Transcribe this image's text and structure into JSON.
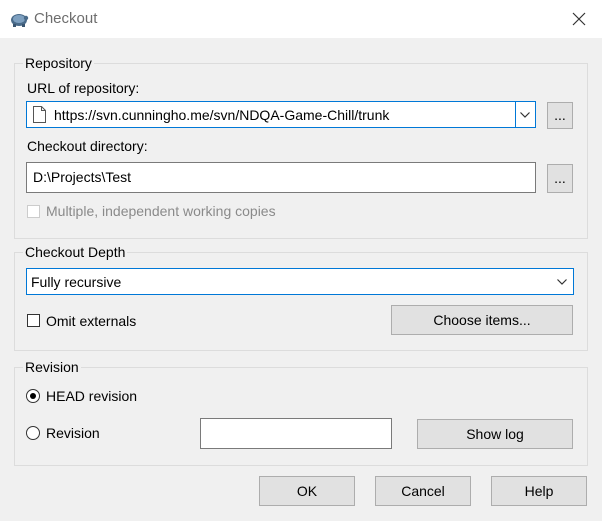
{
  "window": {
    "title": "Checkout",
    "icon": "tortoise-svn-icon",
    "close_icon": "close-icon"
  },
  "repository": {
    "group_label": "Repository",
    "url_label": "URL of repository:",
    "url_value": "https://svn.cunningho.me/svn/NDQA-Game-Chill/trunk",
    "browse_label": "...",
    "checkout_dir_label": "Checkout directory:",
    "checkout_dir_value": "D:\\Projects\\Test",
    "checkout_browse_label": "...",
    "multiple_copies_label": "Multiple, independent working copies",
    "multiple_copies_checked": false,
    "multiple_copies_enabled": false
  },
  "depth": {
    "group_label": "Checkout Depth",
    "selected": "Fully recursive",
    "omit_externals_label": "Omit externals",
    "omit_externals_checked": false,
    "choose_items_label": "Choose items..."
  },
  "revision": {
    "group_label": "Revision",
    "head_label": "HEAD revision",
    "revision_label": "Revision",
    "selected": "HEAD revision",
    "revision_value": "",
    "show_log_label": "Show log"
  },
  "buttons": {
    "ok": "OK",
    "cancel": "Cancel",
    "help": "Help"
  },
  "colors": {
    "focus_border": "#0078d7",
    "button_bg": "#e1e1e1",
    "dialog_bg": "#f0f0f0"
  }
}
